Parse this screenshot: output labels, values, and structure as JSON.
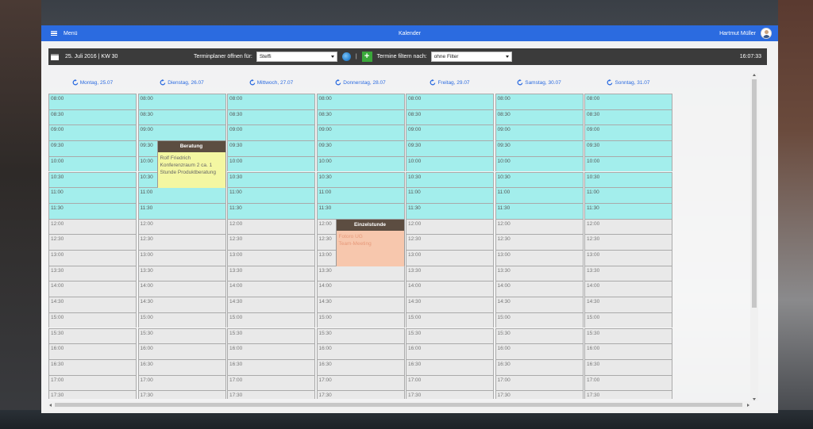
{
  "colors": {
    "topbar": "#2b6be0",
    "toolbar": "#3b3b3b",
    "work_slot": "#a3eeec",
    "free_slot": "#e9e9e9",
    "event_header": "#5c4d41",
    "event_beratung": "#f4f7a2",
    "event_einzel": "#f7c7ad",
    "add_button": "#3aa83a",
    "day_link": "#2b6be0"
  },
  "topbar": {
    "menu_label": "Menü",
    "title": "Kalender",
    "user_name": "Hartmut Müller"
  },
  "toolbar": {
    "date_label": "25. Juli 2016 | KW 30",
    "planner_label": "Terminplaner öffnen für:",
    "planner_value": "Steffi",
    "separator": "|",
    "add_label": "+",
    "filter_label": "Termine filtern nach:",
    "filter_value": "ohne Filter",
    "clock": "16:07:33"
  },
  "days": [
    {
      "label": "Montag, 25.07"
    },
    {
      "label": "Dienstag, 26.07"
    },
    {
      "label": "Mittwoch, 27.07"
    },
    {
      "label": "Donnerstag, 28.07"
    },
    {
      "label": "Freitag, 29.07"
    },
    {
      "label": "Samstag, 30.07"
    },
    {
      "label": "Sonntag, 31.07"
    }
  ],
  "times": [
    "08:00",
    "08:30",
    "09:00",
    "09:30",
    "10:00",
    "10:30",
    "11:00",
    "11:30",
    "12:00",
    "12:30",
    "13:00",
    "13:30",
    "14:00",
    "14:30",
    "15:00",
    "15:30",
    "16:00",
    "16:30",
    "17:00",
    "17:30"
  ],
  "working_hours_slot_count": 8,
  "events": {
    "beratung": {
      "title": "Beratung",
      "line1": "Rolf Friedrich",
      "line2": "Konferenzraum 2 ca. 1",
      "line3": "Stunde Produktberatung"
    },
    "einzel": {
      "title": "Einzelstunde",
      "line1": "Fotoro UG",
      "line2": "Team-Meeting"
    }
  }
}
